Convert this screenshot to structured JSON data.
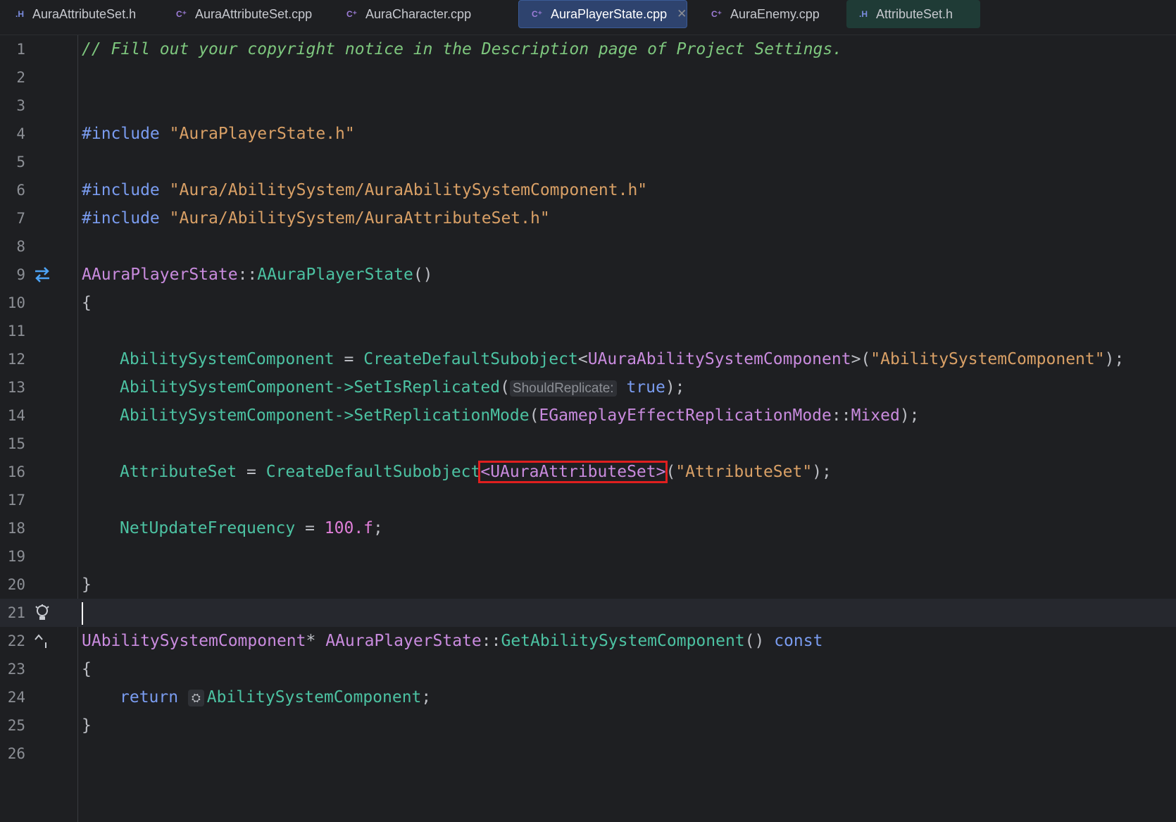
{
  "tabs": [
    {
      "icon": ".H",
      "label": "AuraAttributeSet.h"
    },
    {
      "icon": "C⁺",
      "label": "AuraAttributeSet.cpp"
    },
    {
      "icon": "C⁺",
      "label": "AuraCharacter.cpp"
    },
    {
      "icon": "C⁺",
      "label": "AuraPlayerState.cpp",
      "close": "✕"
    },
    {
      "icon": "C⁺",
      "label": "AuraEnemy.cpp"
    },
    {
      "icon": ".H",
      "label": "AttributeSet.h"
    }
  ],
  "lines": {
    "l1": {
      "num": "1",
      "comment": "// Fill out your copyright notice in the Description page of Project Settings."
    },
    "l2": {
      "num": "2"
    },
    "l3": {
      "num": "3"
    },
    "l4": {
      "num": "4",
      "kw": "#include",
      "str": "\"AuraPlayerState.h\""
    },
    "l5": {
      "num": "5"
    },
    "l6": {
      "num": "6",
      "kw": "#include",
      "str": "\"Aura/AbilitySystem/AuraAbilitySystemComponent.h\""
    },
    "l7": {
      "num": "7",
      "kw": "#include",
      "str": "\"Aura/AbilitySystem/AuraAttributeSet.h\""
    },
    "l8": {
      "num": "8"
    },
    "l9": {
      "num": "9",
      "cls": "AAuraPlayerState",
      "sep": "::",
      "fn": "AAuraPlayerState",
      "rest": "()"
    },
    "l10": {
      "num": "10",
      "text": "{"
    },
    "l11": {
      "num": "11"
    },
    "l12": {
      "num": "12",
      "var": "AbilitySystemComponent",
      "op": " = ",
      "fn": "CreateDefaultSubobject",
      "lt": "<",
      "type": "UAuraAbilitySystemComponent",
      "gt": ">(",
      "str": "\"AbilitySystemComponent\"",
      "end": ");"
    },
    "l13": {
      "num": "13",
      "var": "AbilitySystemComponent",
      "arrow": "->",
      "fn": "SetIsReplicated",
      "open": "(",
      "hint": "ShouldReplicate:",
      "kw": "true",
      "end": ");"
    },
    "l14": {
      "num": "14",
      "var": "AbilitySystemComponent",
      "arrow": "->",
      "fn": "SetReplicationMode",
      "open": "(",
      "type": "EGameplayEffectReplicationMode",
      "sep": "::",
      "member": "Mixed",
      "end": ");"
    },
    "l15": {
      "num": "15"
    },
    "l16": {
      "num": "16",
      "var": "AttributeSet",
      "op": " = ",
      "fn": "CreateDefaultSubobject",
      "boxed": "<UAuraAttributeSet>",
      "open": "(",
      "str": "\"AttributeSet\"",
      "end": ");"
    },
    "l17": {
      "num": "17"
    },
    "l18": {
      "num": "18",
      "var": "NetUpdateFrequency",
      "op": " = ",
      "numval": "100.f",
      "end": ";"
    },
    "l19": {
      "num": "19"
    },
    "l20": {
      "num": "20",
      "text": "}"
    },
    "l21": {
      "num": "21"
    },
    "l22": {
      "num": "22",
      "type": "UAbilitySystemComponent",
      "star": "* ",
      "cls": "AAuraPlayerState",
      "sep": "::",
      "fn": "GetAbilitySystemComponent",
      "rest": "() ",
      "kw": "const"
    },
    "l23": {
      "num": "23",
      "text": "{"
    },
    "l24": {
      "num": "24",
      "kw": "return",
      "badge": "⛭",
      "var": "AbilitySystemComponent",
      "end": ";"
    },
    "l25": {
      "num": "25",
      "text": "}"
    },
    "l26": {
      "num": "26"
    }
  },
  "colors": {
    "accent": "#2e436e",
    "highlight_box": "#e01f1f",
    "background": "#1e1f22"
  }
}
